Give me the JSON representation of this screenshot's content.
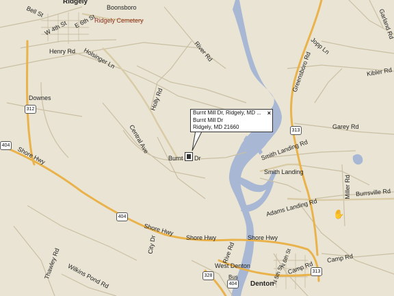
{
  "colors": {
    "background": "#e9e4d4",
    "water": "#a7b7d4",
    "highway": "#e9b24a",
    "road": "#cbbfa3"
  },
  "towns": {
    "ridgely": "Ridgely",
    "boonsboro": "Boonsboro",
    "ridgely_cemetery": "Ridgely Cemetery",
    "downes": "Downes",
    "smith_landing": "Smith Landing",
    "west_denton": "West Denton",
    "denton": "Denton"
  },
  "roads": {
    "bell_st": "Bell St",
    "w_4th_st": "W 4th St",
    "e_6th_st": "E 6th St",
    "henry_rd": "Henry Rd",
    "holsinger_ln": "Holsinger Ln",
    "river_rd": "River Rd",
    "holly_rd": "Holly Rd",
    "central_ave": "Central Ave",
    "shore_hwy_west": "Shore Hwy",
    "shore_hwy_mid": "Shore Hwy",
    "shore_hwy_right1": "Shore Hwy",
    "shore_hwy_right2": "Shore Hwy",
    "burnt_left": "Burnt",
    "burnt_right": "Dr",
    "greensboro_rd": "Greensboro Rd",
    "jopp_ln": "Jopp Ln",
    "kibler_rd": "Kibler Rd",
    "garland_rd": "Garland Rd",
    "garey_rd": "Garey Rd",
    "smith_landing_rd": "Smith Landing Rd",
    "adams_landing_rd": "Adams Landing Rd",
    "burrsville_rd": "Burrsville Rd",
    "miller_rd": "Miller Rd",
    "thawley_rd": "Thawley Rd",
    "wilkins_pond_rd": "Wilkins Pond Rd",
    "city_dr": "City Dr",
    "rive_rd": "Rive Rd",
    "camp_rd_1": "Camp Rd",
    "camp_rd_2": "Camp Rd",
    "n_5th_st": "N 5th St",
    "n_6th_st": "N 6th St",
    "bus": "Bus"
  },
  "shields": {
    "r312": "312",
    "r404_west": "404",
    "r404_mid": "404",
    "r404_bus": "404",
    "r313_north": "313",
    "r313_south": "313",
    "r328": "328"
  },
  "popup": {
    "title": "Burnt Mill Dr, Ridgely, MD ...",
    "line1": "Burnt Mill Dr",
    "line2": "Ridgely, MD 21660",
    "close_glyph": "×"
  }
}
